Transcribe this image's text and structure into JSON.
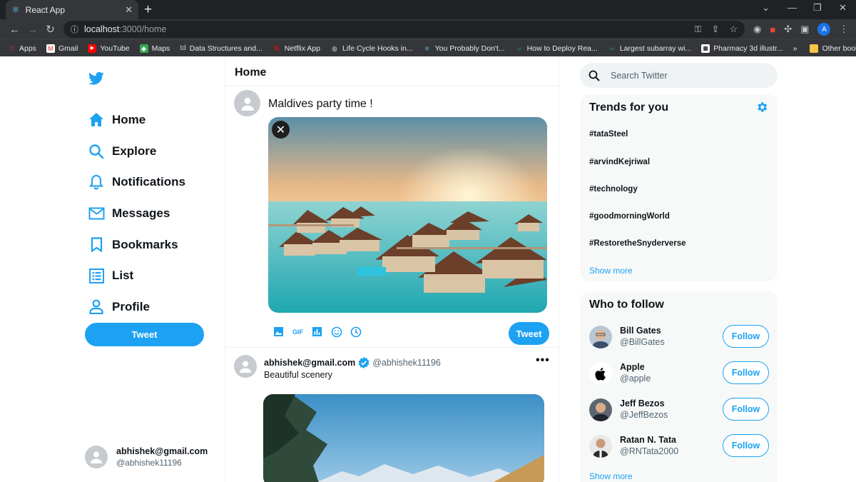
{
  "browser": {
    "tab_title": "React App",
    "url_host": "localhost",
    "url_path": ":3000/home",
    "profile_initial": "A",
    "bookmarks": [
      "Apps",
      "Gmail",
      "YouTube",
      "Maps",
      "Data Structures and...",
      "Netflix App",
      "Life Cycle Hooks in...",
      "You Probably Don't...",
      "How to Deploy Rea...",
      "Largest subarray wi...",
      "Pharmacy 3d illustr..."
    ],
    "other_bookmarks": "Other bookmarks",
    "td_label": "td"
  },
  "sidebar": {
    "items": [
      {
        "label": "Home",
        "icon": "home-icon"
      },
      {
        "label": "Explore",
        "icon": "search-icon"
      },
      {
        "label": "Notifications",
        "icon": "bell-icon"
      },
      {
        "label": "Messages",
        "icon": "mail-icon"
      },
      {
        "label": "Bookmarks",
        "icon": "bookmark-icon"
      },
      {
        "label": "List",
        "icon": "list-icon"
      },
      {
        "label": "Profile",
        "icon": "person-icon"
      }
    ],
    "tweet_button": "Tweet",
    "user": {
      "name": "abhishek@gmail.com",
      "handle": "@abhishek11196"
    }
  },
  "feed": {
    "title": "Home",
    "compose": {
      "text": "Maldives party time !",
      "tweet_button": "Tweet",
      "gif_label": "GIF"
    },
    "post": {
      "name": "abhishek@gmail.com",
      "handle": "@abhishek11196",
      "text": "Beautiful scenery"
    }
  },
  "right": {
    "search_placeholder": "Search Twitter",
    "trends": {
      "title": "Trends for you",
      "items": [
        "#tataSteel",
        "#arvindKejriwal",
        "#technology",
        "#goodmorningWorld",
        "#RestoretheSnyderverse"
      ],
      "show_more": "Show more"
    },
    "who_to_follow": {
      "title": "Who to follow",
      "users": [
        {
          "name": "Bill Gates",
          "handle": "@BillGates",
          "button": "Follow"
        },
        {
          "name": "Apple",
          "handle": "@apple",
          "button": "Follow"
        },
        {
          "name": "Jeff Bezos",
          "handle": "@JeffBezos",
          "button": "Follow"
        },
        {
          "name": "Ratan N. Tata",
          "handle": "@RNTata2000",
          "button": "Follow"
        }
      ],
      "show_more": "Show more"
    }
  },
  "colors": {
    "accent": "#1DA1F2",
    "text": "#0F1419",
    "muted": "#536471"
  }
}
